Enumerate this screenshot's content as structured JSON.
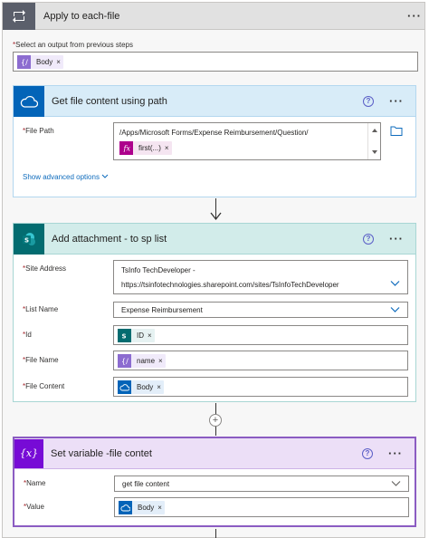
{
  "loop": {
    "title": "Apply to each-file",
    "select_label": "Select an output from previous steps",
    "token": "Body"
  },
  "get_file": {
    "title": "Get file content using path",
    "help": "?",
    "file_path_label": "File Path",
    "file_path_value": "/Apps/Microsoft Forms/Expense Reimbursement/Question/",
    "expr_token": "first(...)",
    "show_advanced": "Show advanced options"
  },
  "add_attachment": {
    "title": "Add attachment - to sp list",
    "help": "?",
    "site_label": "Site Address",
    "site_value_line1": "TsInfo TechDeveloper -",
    "site_value_line2": "https://tsinfotechnologies.sharepoint.com/sites/TsInfoTechDeveloper",
    "list_label": "List Name",
    "list_value": "Expense Reimbursement",
    "id_label": "Id",
    "id_token": "ID",
    "file_name_label": "File Name",
    "file_name_token": "name",
    "file_content_label": "File Content",
    "file_content_token": "Body"
  },
  "set_var": {
    "title": "Set variable -file contet",
    "help": "?",
    "icon_text": "{x}",
    "name_label": "Name",
    "name_value": "get file content",
    "value_label": "Value",
    "value_token": "Body"
  },
  "common": {
    "remove": "×",
    "dots": "···",
    "required": "*"
  },
  "colors": {
    "onedrive": "#0364b8",
    "sharepoint": "#036c70",
    "variable": "#770bd6",
    "expression": "#ad008c",
    "dynamic": "#8c6cd0"
  },
  "icons": [
    "loop-icon",
    "onedrive-icon",
    "sharepoint-icon",
    "variable-icon",
    "expression-icon",
    "dynamic-content-icon",
    "chevron-down-icon",
    "folder-icon",
    "help-icon",
    "arrow-down-icon",
    "add-step-icon"
  ]
}
